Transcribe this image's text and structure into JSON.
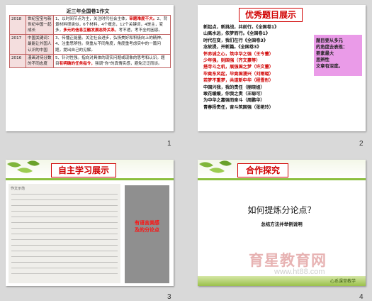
{
  "slides": [
    {
      "number": "1",
      "table_title": "近三年全国卷1作文",
      "rows": [
        {
          "year": "2018",
          "theme": "世纪宝宝与新世纪中国一起成长",
          "lines": [
            {
              "text": "1、以时间节点为主，关注时代社会主体，",
              "red": false
            },
            {
              "text": "审题难度不大。",
              "red": true
            },
            {
              "text": "2、背景材料很类似，6个材料，4个概念，",
              "red": false
            },
            {
              "text": "12个关键词，4是主，变多，",
              "red": false
            },
            {
              "text": "多元的信息互融发展态势关系，",
              "red": true
            },
            {
              "text": "考不透，考不全的困惑。",
              "red": false
            }
          ]
        },
        {
          "year": "2017",
          "theme": "中国关键词：最能让外国人认识的中国",
          "lines": [
            {
              "text": "3、传播正能量。关注社会进步，弘扬美好和积极向上的精神。",
              "red": false
            },
            {
              "text": "4、注重思辨性。侧重从不同角度，角度重考虑实中的一篇问题，提出自己的见解。",
              "red": false
            }
          ]
        },
        {
          "year": "2016",
          "theme": "漫画对待分数的不同态度",
          "lines": [
            {
              "text": "5、针对性强。指向对具体的现实问题或现象的思考和认识。题目",
              "red": false
            },
            {
              "text": "有明确的任务指令，",
              "red": true
            },
            {
              "text": "强调\"你\"的真情实感，避免泛泛而谈。",
              "red": false
            }
          ]
        }
      ]
    },
    {
      "number": "2",
      "title": "优秀题目展示",
      "lines": [
        {
          "text": "新起点，新挑战，共前行。《全国卷1》",
          "color": "black"
        },
        {
          "text": "山高水远，依梦而行。《全国卷1》",
          "color": "black"
        },
        {
          "text": "时代在变，我们在行《全国卷3》",
          "color": "black"
        },
        {
          "text": "念故提，开新篇。《全国卷3》",
          "color": "black"
        },
        {
          "text": "怀赤诚之心，筑中华之强（王今蕾）",
          "color": "red"
        },
        {
          "text": "少年强，则国强（齐文豪等）",
          "color": "red"
        },
        {
          "text": "搭寺斗之机，展强国之梦（许文蕾）",
          "color": "red"
        },
        {
          "text": "毕竟东风起，毕竟国漫兴（刘雨璐）",
          "color": "red"
        },
        {
          "text": "若梦不重梦，共道新中华（程雪彤）",
          "color": "red"
        },
        {
          "text": "中国兴我，我的责任（丽晓姐）",
          "color": "black"
        },
        {
          "text": "敢花缓缓，你我之责（王聪可）",
          "color": "black"
        },
        {
          "text": "为中华之嘉强而奋斗（周鹏华）",
          "color": "black"
        },
        {
          "text": "青春扬责任，奋斗筑国强（张艳玲）",
          "color": "black"
        }
      ],
      "side_note": [
        "题目要从多元",
        "的角度去表现：",
        "要素最大",
        "思辨性",
        "文章有深度。"
      ]
    },
    {
      "number": "3",
      "title": "自主学习展示",
      "paper_heading": "作文示范",
      "side_note": [
        "有语言美感",
        "及的分论点"
      ]
    },
    {
      "number": "4",
      "title": "合作探究",
      "question": "如何提炼分论点？",
      "subtitle": "总结方法并举例说明",
      "watermark": "育星教育网",
      "watermark_url": "www.ht88.com",
      "footer": "心系课堂教学"
    }
  ],
  "colors": {
    "accent_red": "#d00000",
    "leaf_green": "#8cbf3f",
    "pink_box": "#ea9be8"
  }
}
